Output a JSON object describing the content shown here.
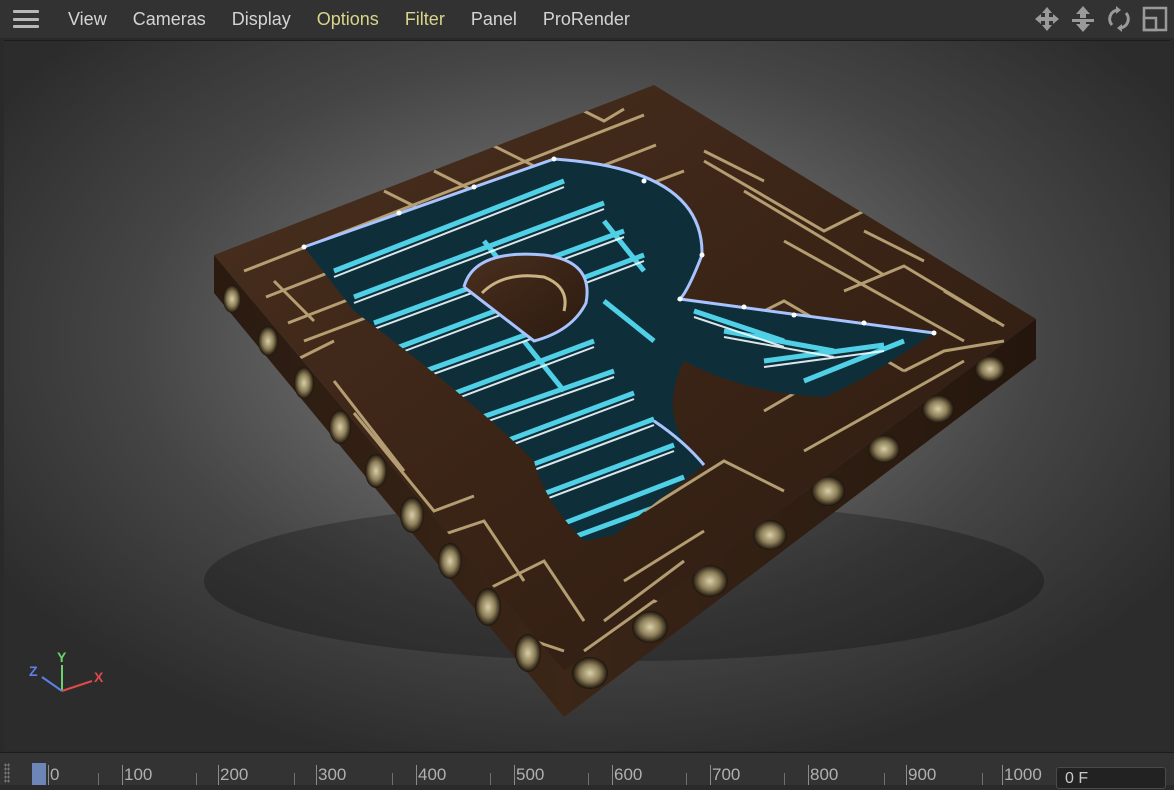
{
  "menu": {
    "items": [
      {
        "label": "View",
        "highlight": false
      },
      {
        "label": "Cameras",
        "highlight": false
      },
      {
        "label": "Display",
        "highlight": false
      },
      {
        "label": "Options",
        "highlight": true
      },
      {
        "label": "Filter",
        "highlight": true
      },
      {
        "label": "Panel",
        "highlight": false
      },
      {
        "label": "ProRender",
        "highlight": false
      }
    ],
    "nav_icons": [
      "move-view-icon",
      "dolly-view-icon",
      "rotate-view-icon",
      "toggle-panel-icon"
    ]
  },
  "viewport": {
    "object": "wooden maze plate with letter R cutout",
    "axis": {
      "x": "X",
      "y": "Y",
      "z": "Z"
    }
  },
  "timeline": {
    "labels": [
      "0",
      "100",
      "200",
      "300",
      "400",
      "500",
      "600",
      "700",
      "800",
      "900",
      "1000"
    ],
    "current_frame": "0 F"
  },
  "colors": {
    "menu_highlight": "#d8d58a",
    "maze_cyan": "#35c3db",
    "spline": "#a8c4ff",
    "wood": "#3a2518",
    "brass": "#c9b382"
  }
}
